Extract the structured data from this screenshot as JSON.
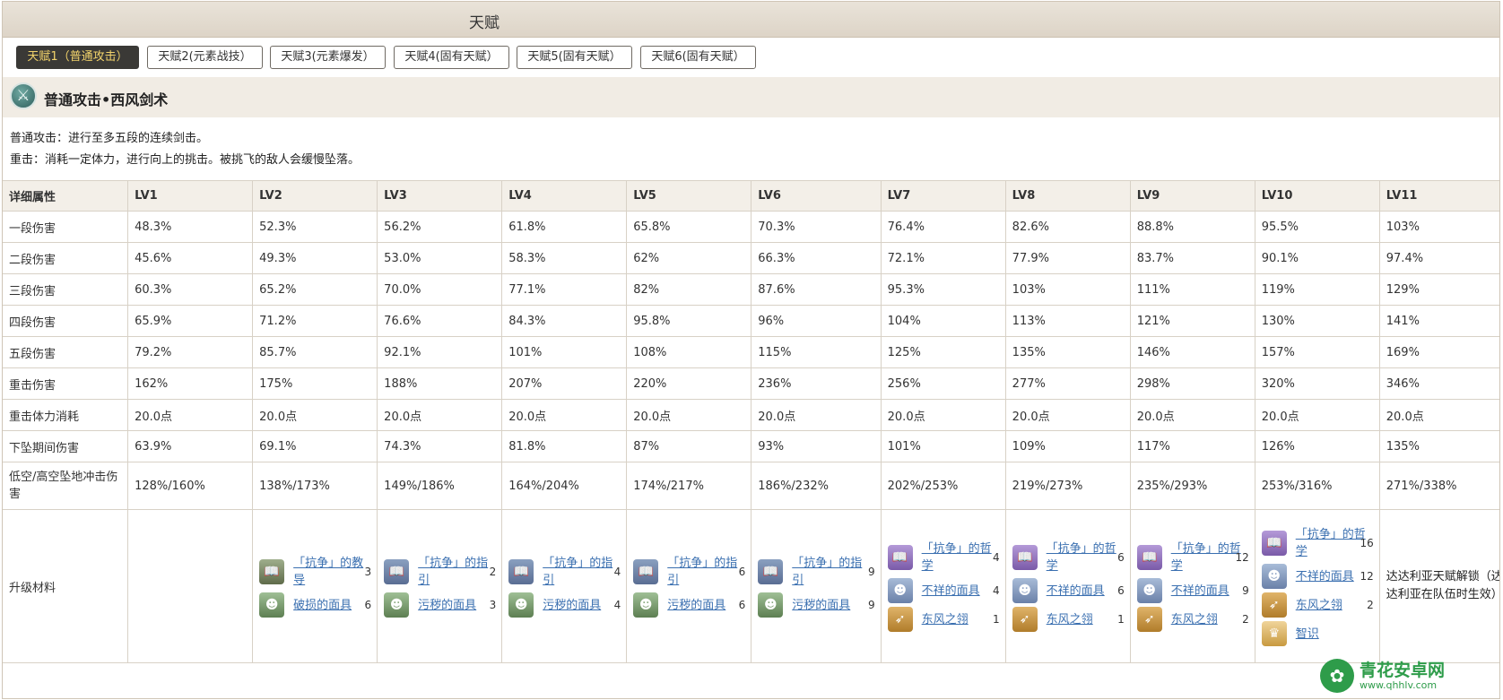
{
  "window": {
    "title": "天赋"
  },
  "tabs": [
    {
      "label": "天赋1（普通攻击）",
      "active": true
    },
    {
      "label": "天赋2(元素战技）"
    },
    {
      "label": "天赋3(元素爆发）"
    },
    {
      "label": "天赋4(固有天赋）"
    },
    {
      "label": "天赋5(固有天赋）"
    },
    {
      "label": "天赋6(固有天赋）"
    }
  ],
  "skill": {
    "icon": "sword-skill-icon",
    "name": "普通攻击•西风剑术",
    "desc1": "普通攻击：进行至多五段的连续剑击。",
    "desc2": "重击：消耗一定体力，进行向上的挑击。被挑飞的敌人会缓慢坠落。"
  },
  "table": {
    "headers": [
      "详细属性",
      "LV1",
      "LV2",
      "LV3",
      "LV4",
      "LV5",
      "LV6",
      "LV7",
      "LV8",
      "LV9",
      "LV10",
      "LV11"
    ],
    "rows": [
      [
        "一段伤害",
        "48.3%",
        "52.3%",
        "56.2%",
        "61.8%",
        "65.8%",
        "70.3%",
        "76.4%",
        "82.6%",
        "88.8%",
        "95.5%",
        "103%"
      ],
      [
        "二段伤害",
        "45.6%",
        "49.3%",
        "53.0%",
        "58.3%",
        "62%",
        "66.3%",
        "72.1%",
        "77.9%",
        "83.7%",
        "90.1%",
        "97.4%"
      ],
      [
        "三段伤害",
        "60.3%",
        "65.2%",
        "70.0%",
        "77.1%",
        "82%",
        "87.6%",
        "95.3%",
        "103%",
        "111%",
        "119%",
        "129%"
      ],
      [
        "四段伤害",
        "65.9%",
        "71.2%",
        "76.6%",
        "84.3%",
        "95.8%",
        "96%",
        "104%",
        "113%",
        "121%",
        "130%",
        "141%"
      ],
      [
        "五段伤害",
        "79.2%",
        "85.7%",
        "92.1%",
        "101%",
        "108%",
        "115%",
        "125%",
        "135%",
        "146%",
        "157%",
        "169%"
      ],
      [
        "重击伤害",
        "162%",
        "175%",
        "188%",
        "207%",
        "220%",
        "236%",
        "256%",
        "277%",
        "298%",
        "320%",
        "346%"
      ],
      [
        "重击体力消耗",
        "20.0点",
        "20.0点",
        "20.0点",
        "20.0点",
        "20.0点",
        "20.0点",
        "20.0点",
        "20.0点",
        "20.0点",
        "20.0点",
        "20.0点"
      ],
      [
        "下坠期间伤害",
        "63.9%",
        "69.1%",
        "74.3%",
        "81.8%",
        "87%",
        "93%",
        "101%",
        "109%",
        "117%",
        "126%",
        "135%"
      ],
      [
        "低空/高空坠地冲击伤害",
        "128%/160%",
        "138%/173%",
        "149%/186%",
        "164%/204%",
        "174%/217%",
        "186%/232%",
        "202%/253%",
        "219%/273%",
        "235%/293%",
        "253%/316%",
        "271%/338%"
      ]
    ],
    "materials_label": "升级材料",
    "materials": [
      [],
      [
        {
          "icon": "book-icon",
          "cls": "book1",
          "name": "「抗争」的教导",
          "count": "3"
        },
        {
          "icon": "mask-icon",
          "cls": "mask",
          "name": "破损的面具",
          "count": "6"
        }
      ],
      [
        {
          "icon": "book-icon",
          "cls": "book2",
          "name": "「抗争」的指引",
          "count": "2"
        },
        {
          "icon": "mask-icon",
          "cls": "mask",
          "name": "污秽的面具",
          "count": "3"
        }
      ],
      [
        {
          "icon": "book-icon",
          "cls": "book2",
          "name": "「抗争」的指引",
          "count": "4"
        },
        {
          "icon": "mask-icon",
          "cls": "mask",
          "name": "污秽的面具",
          "count": "4"
        }
      ],
      [
        {
          "icon": "book-icon",
          "cls": "book2",
          "name": "「抗争」的指引",
          "count": "6"
        },
        {
          "icon": "mask-icon",
          "cls": "mask",
          "name": "污秽的面具",
          "count": "6"
        }
      ],
      [
        {
          "icon": "book-icon",
          "cls": "book2",
          "name": "「抗争」的指引",
          "count": "9"
        },
        {
          "icon": "mask-icon",
          "cls": "mask",
          "name": "污秽的面具",
          "count": "9"
        }
      ],
      [
        {
          "icon": "book-icon",
          "cls": "book3",
          "name": "「抗争」的哲学",
          "count": "4"
        },
        {
          "icon": "mask-icon",
          "cls": "mask2",
          "name": "不祥的面具",
          "count": "4"
        },
        {
          "icon": "wing-icon",
          "cls": "wing",
          "name": "东风之翎",
          "count": "1"
        }
      ],
      [
        {
          "icon": "book-icon",
          "cls": "book3",
          "name": "「抗争」的哲学",
          "count": "6"
        },
        {
          "icon": "mask-icon",
          "cls": "mask2",
          "name": "不祥的面具",
          "count": "6"
        },
        {
          "icon": "wing-icon",
          "cls": "wing",
          "name": "东风之翎",
          "count": "1"
        }
      ],
      [
        {
          "icon": "book-icon",
          "cls": "book3",
          "name": "「抗争」的哲学",
          "count": "12"
        },
        {
          "icon": "mask-icon",
          "cls": "mask2",
          "name": "不祥的面具",
          "count": "9"
        },
        {
          "icon": "wing-icon",
          "cls": "wing",
          "name": "东风之翎",
          "count": "2"
        }
      ],
      [
        {
          "icon": "book-icon",
          "cls": "book3",
          "name": "「抗争」的哲学",
          "count": "16"
        },
        {
          "icon": "mask-icon",
          "cls": "mask2",
          "name": "不祥的面具",
          "count": "12"
        },
        {
          "icon": "wing-icon",
          "cls": "wing",
          "name": "东风之翎",
          "count": "2"
        },
        {
          "icon": "crown-icon",
          "cls": "crown",
          "name": "智识",
          "count": ""
        }
      ],
      {
        "note": "达达利亚天赋解锁（达达利亚在队伍时生效）"
      }
    ]
  },
  "watermark": {
    "title": "青花安卓网",
    "url": "www.qhhlv.com",
    "icon": "watermark-logo-icon"
  }
}
